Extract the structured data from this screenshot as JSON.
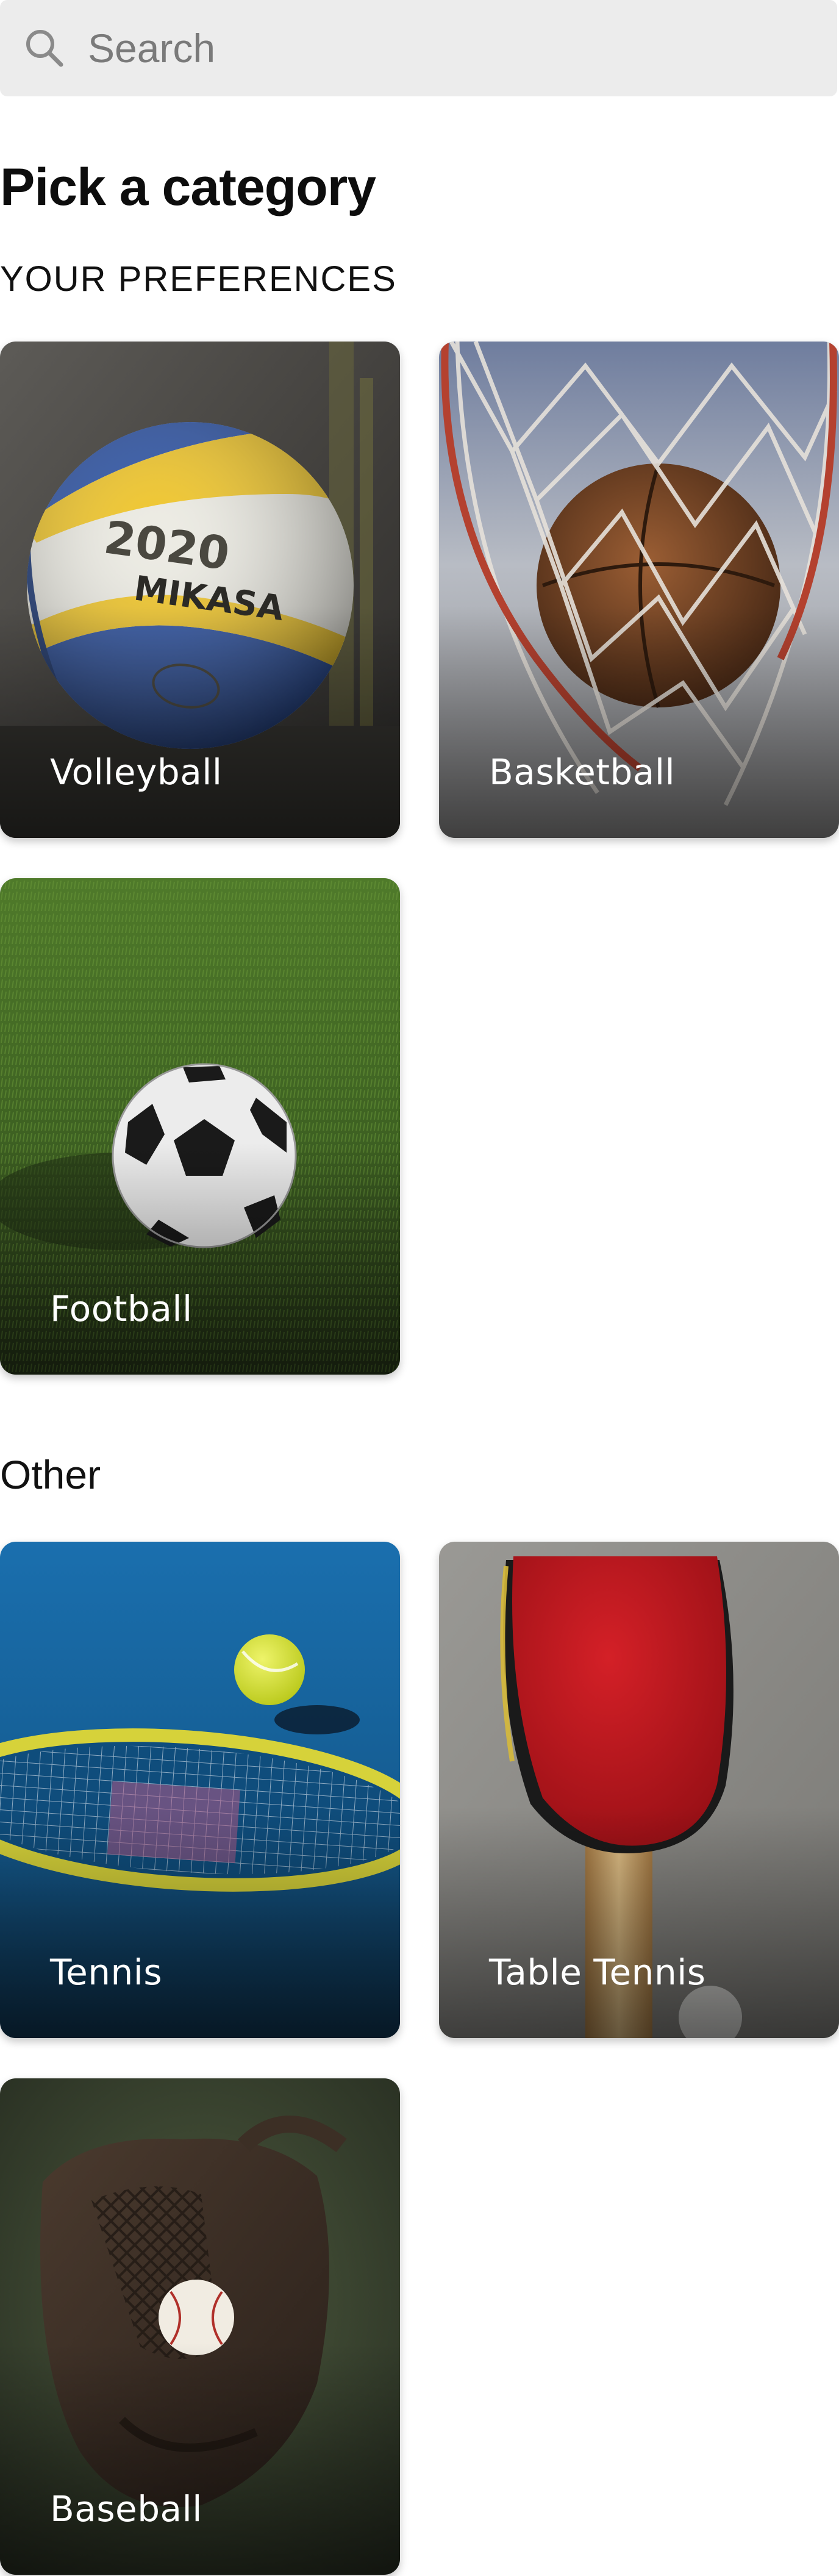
{
  "search": {
    "placeholder": "Search",
    "icon": "search-icon"
  },
  "header": {
    "title": "Pick a category"
  },
  "preferences": {
    "label": "YOUR PREFERENCES",
    "items": [
      {
        "label": "Volleyball",
        "ball_print": "2020",
        "ball_brand": "MIKASA"
      },
      {
        "label": "Basketball"
      },
      {
        "label": "Football"
      }
    ]
  },
  "other": {
    "title": "Other",
    "items": [
      {
        "label": "Tennis"
      },
      {
        "label": "Table Tennis"
      },
      {
        "label": "Baseball"
      }
    ]
  },
  "colors": {
    "search_bg": "#ececec",
    "card_text": "#ffffff",
    "title_text": "#0d0d0d"
  }
}
